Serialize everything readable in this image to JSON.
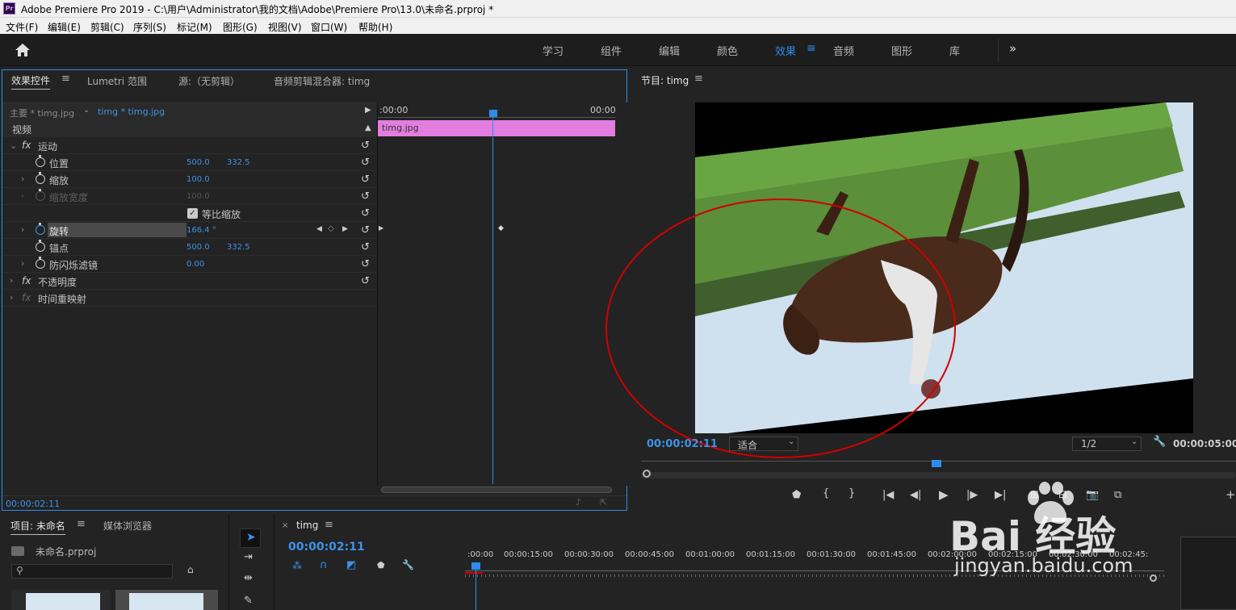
{
  "window": {
    "app_icon": "Pr",
    "title": "Adobe Premiere Pro 2019 - C:\\用户\\Administrator\\我的文档\\Adobe\\Premiere Pro\\13.0\\未命名.prproj *"
  },
  "menu": [
    "文件(F)",
    "编辑(E)",
    "剪辑(C)",
    "序列(S)",
    "标记(M)",
    "图形(G)",
    "视图(V)",
    "窗口(W)",
    "帮助(H)"
  ],
  "workspaces": [
    "学习",
    "组件",
    "编辑",
    "颜色",
    "效果",
    "音频",
    "图形",
    "库"
  ],
  "active_workspace": "效果",
  "effect_controls": {
    "tabs": [
      "效果控件",
      "Lumetri 范围",
      "源:（无剪辑）",
      "音频剪辑混合器: timg"
    ],
    "master": "主要 * timg.jpg",
    "clip": "timg * timg.jpg",
    "time_start": ":00:00",
    "time_end": "00:00",
    "clip_bar": "timg.jpg",
    "section_video": "视频",
    "motion": "运动",
    "position_label": "位置",
    "position_x": "500.0",
    "position_y": "332.5",
    "scale_label": "缩放",
    "scale": "100.0",
    "scale_width_label": "缩放宽度",
    "scale_width": "100.0",
    "uniform_scale_label": "等比缩放",
    "rotation_label": "旋转",
    "rotation": "166.4 °",
    "anchor_label": "锚点",
    "anchor_x": "500.0",
    "anchor_y": "332.5",
    "flicker_label": "防闪烁滤镜",
    "flicker": "0.00",
    "opacity": "不透明度",
    "time_remap": "时间重映射",
    "fx": "fx",
    "timecode": "00:00:02:11"
  },
  "program_monitor": {
    "title": "节目: timg",
    "timecode": "00:00:02:11",
    "fit": "适合",
    "resolution": "1/2",
    "duration": "00:00:05:00"
  },
  "project": {
    "tabs": [
      "项目: 未命名",
      "媒体浏览器"
    ],
    "file": "未命名.prproj"
  },
  "timeline": {
    "tab": "timg",
    "timecode": "00:00:02:11",
    "ruler": [
      ":00:00",
      "00:00:15:00",
      "00:00:30:00",
      "00:00:45:00",
      "00:01:00:00",
      "00:01:15:00",
      "00:01:30:00",
      "00:01:45:00",
      "00:02:00:00",
      "00:02:15:00",
      "00:02:30:00",
      "00:02:45:"
    ]
  },
  "watermark": {
    "brand": "Bai 经验",
    "url": "jingyan.baidu.com"
  },
  "colors": {
    "accent": "#2d8ceb",
    "clip": "#e27ee0",
    "annotation": "#d00000"
  }
}
